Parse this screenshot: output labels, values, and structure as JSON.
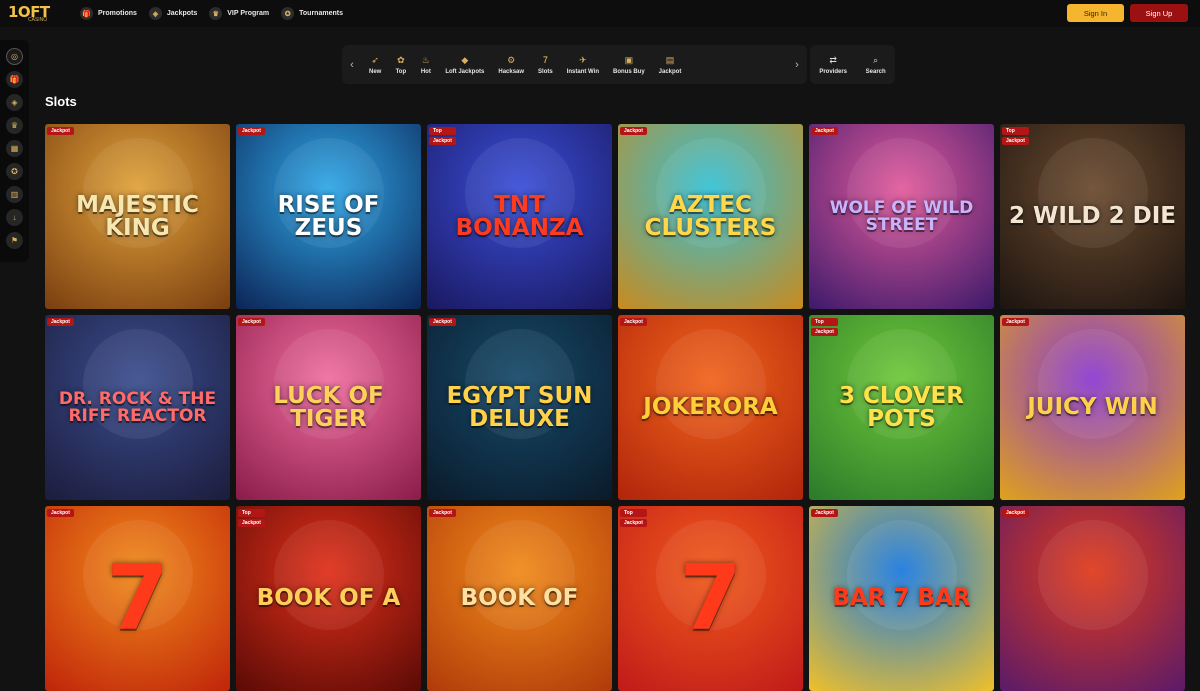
{
  "header": {
    "logo": "1OFT",
    "logo_sub": "CASINO",
    "nav": [
      {
        "label": "Promotions",
        "icon": "gift-icon"
      },
      {
        "label": "Jackpots",
        "icon": "jackpot-icon"
      },
      {
        "label": "VIP Program",
        "icon": "crown-icon"
      },
      {
        "label": "Tournaments",
        "icon": "medal-icon"
      }
    ],
    "signin": "Sign In",
    "signup": "Sign Up"
  },
  "categories": [
    {
      "label": "New",
      "icon": "rocket-icon"
    },
    {
      "label": "Top",
      "icon": "badge-icon"
    },
    {
      "label": "Hot",
      "icon": "fire-icon"
    },
    {
      "label": "Loft Jackpots",
      "icon": "diamond-icon"
    },
    {
      "label": "Hacksaw",
      "icon": "saw-icon"
    },
    {
      "label": "Slots",
      "icon": "slots-icon",
      "active": true
    },
    {
      "label": "Instant Win",
      "icon": "plane-icon"
    },
    {
      "label": "Bonus Buy",
      "icon": "giftbox-icon"
    },
    {
      "label": "Jackpot",
      "icon": "chest-icon"
    }
  ],
  "tools": {
    "providers": "Providers",
    "search": "Search"
  },
  "section_title": "Slots",
  "games": [
    {
      "title": "MAJESTIC KING",
      "badges": [
        "Jackpot"
      ],
      "colors": [
        "#e0a23a",
        "#7a3e10"
      ],
      "text": "#f6e6b0"
    },
    {
      "title": "RISE OF ZEUS",
      "badges": [
        "Jackpot"
      ],
      "colors": [
        "#2fa8e8",
        "#0c2456"
      ],
      "text": "#ffffff"
    },
    {
      "title": "TNT BONANZA",
      "badges": [
        "Top",
        "Jackpot"
      ],
      "colors": [
        "#3a4fd8",
        "#1a1860"
      ],
      "text": "#ff3b1f"
    },
    {
      "title": "AZTEC CLUSTERS",
      "badges": [
        "Jackpot"
      ],
      "colors": [
        "#34c1d6",
        "#c98a1e"
      ],
      "text": "#ffd84a"
    },
    {
      "title": "WOLF OF WILD STREET",
      "badges": [
        "Jackpot"
      ],
      "colors": [
        "#e25a9c",
        "#3c1a6a"
      ],
      "text": "#c9b3ff"
    },
    {
      "title": "2 WILD 2 DIE",
      "badges": [
        "Top",
        "Jackpot"
      ],
      "colors": [
        "#6b4a2e",
        "#1c1410"
      ],
      "text": "#f2e6d0"
    },
    {
      "title": "DR. ROCK & THE RIFF REACTOR",
      "badges": [
        "Jackpot"
      ],
      "colors": [
        "#3a4d8e",
        "#1c1c3c"
      ],
      "text": "#ff6a6a"
    },
    {
      "title": "LUCK OF TIGER",
      "badges": [
        "Jackpot"
      ],
      "colors": [
        "#f06ea0",
        "#8a1c48"
      ],
      "text": "#ffd15a"
    },
    {
      "title": "EGYPT SUN DELUXE",
      "badges": [
        "Jackpot"
      ],
      "colors": [
        "#164a6a",
        "#0a1a2a"
      ],
      "text": "#ffd24a"
    },
    {
      "title": "JOKERORA",
      "badges": [
        "Jackpot"
      ],
      "colors": [
        "#f0641c",
        "#b0240c"
      ],
      "text": "#ffcf3a"
    },
    {
      "title": "3 CLOVER POTS",
      "badges": [
        "Top",
        "Jackpot"
      ],
      "colors": [
        "#6fc83a",
        "#2a7a2a"
      ],
      "text": "#ffe14a"
    },
    {
      "title": "JUICY WIN",
      "badges": [
        "Jackpot"
      ],
      "colors": [
        "#8a3ad0",
        "#e0a21a"
      ],
      "text": "#ffd04a"
    },
    {
      "title": "7",
      "badges": [
        "Jackpot"
      ],
      "colors": [
        "#f08a1a",
        "#c0240a"
      ],
      "text": "#ff3a1a"
    },
    {
      "title": "BOOK OF A",
      "badges": [
        "Top",
        "Jackpot"
      ],
      "colors": [
        "#e0301a",
        "#5a0a06"
      ],
      "text": "#ffcf5a"
    },
    {
      "title": "BOOK OF",
      "badges": [
        "Jackpot"
      ],
      "colors": [
        "#f08a1a",
        "#b03a0a"
      ],
      "text": "#ffe0a0"
    },
    {
      "title": "7",
      "badges": [
        "Top",
        "Jackpot"
      ],
      "colors": [
        "#f05a1a",
        "#c01a1a"
      ],
      "text": "#ff3a1a"
    },
    {
      "title": "BAR 7 BAR",
      "badges": [
        "Jackpot"
      ],
      "colors": [
        "#1a7ae0",
        "#f0c02a"
      ],
      "text": "#ff3a1a"
    },
    {
      "title": "",
      "badges": [
        "Jackpot"
      ],
      "colors": [
        "#e03a1a",
        "#5a1a6a"
      ],
      "text": "#ffd04a"
    }
  ],
  "sidebar": [
    "spin-icon",
    "gift-icon",
    "jackpot-icon",
    "crown-icon",
    "ticket-icon",
    "medal-icon",
    "cards-icon",
    "download-icon",
    "flag-icon"
  ]
}
